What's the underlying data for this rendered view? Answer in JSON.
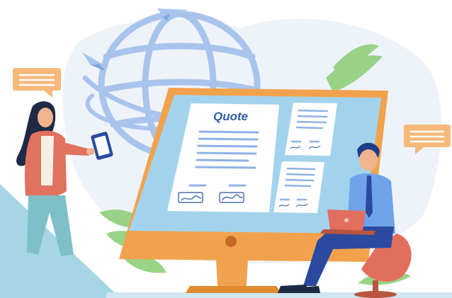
{
  "document": {
    "title": "Quote"
  },
  "colors": {
    "background_blob": "#eef3fa",
    "globe": "#a9c4ec",
    "monitor_frame": "#f2a24d",
    "monitor_screen": "#a3d3ec",
    "paper": "#ffffff",
    "text_lines": "#8fb2e6",
    "title": "#2f5fa7",
    "speech_bubble": "#f6b97a",
    "leaf_green": "#8fcf7a",
    "floor": "#a6d6e6",
    "woman_jacket": "#e0725f",
    "man_shirt": "#6fa3ea",
    "man_pants": "#2a4aa0",
    "chair": "#e26e5e",
    "laptop": "#e26e5e"
  },
  "icons": [
    "paper-plane-icon",
    "speech-bubble-icon",
    "globe-icon",
    "signature-icon",
    "tablet-icon",
    "laptop-icon"
  ]
}
